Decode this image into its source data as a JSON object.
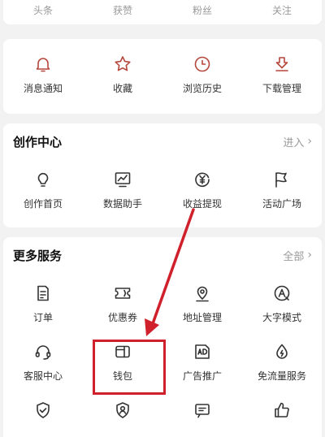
{
  "stats": [
    "头条",
    "获赞",
    "粉丝",
    "关注"
  ],
  "quick": [
    {
      "label": "消息通知",
      "icon": "bell-icon"
    },
    {
      "label": "收藏",
      "icon": "star-icon"
    },
    {
      "label": "浏览历史",
      "icon": "clock-icon"
    },
    {
      "label": "下载管理",
      "icon": "download-icon"
    }
  ],
  "creator": {
    "title": "创作中心",
    "link": "进入",
    "items": [
      {
        "label": "创作首页",
        "icon": "lightbulb-icon"
      },
      {
        "label": "数据助手",
        "icon": "chart-icon"
      },
      {
        "label": "收益提现",
        "icon": "yen-coin-icon"
      },
      {
        "label": "活动广场",
        "icon": "flag-icon"
      }
    ]
  },
  "more": {
    "title": "更多服务",
    "link": "全部",
    "rows": [
      [
        {
          "label": "订单",
          "icon": "document-icon"
        },
        {
          "label": "优惠券",
          "icon": "coupon-icon"
        },
        {
          "label": "地址管理",
          "icon": "location-pin-icon"
        },
        {
          "label": "大字模式",
          "icon": "large-text-icon"
        }
      ],
      [
        {
          "label": "客服中心",
          "icon": "headset-icon"
        },
        {
          "label": "钱包",
          "icon": "wallet-icon"
        },
        {
          "label": "广告推广",
          "icon": "ad-icon"
        },
        {
          "label": "免流量服务",
          "icon": "water-drop-icon"
        }
      ]
    ],
    "partial_icons": [
      "shield-check-icon",
      "user-badge-icon",
      "message-icon",
      "thumbs-up-icon"
    ]
  },
  "colors": {
    "accent": "#b5473d",
    "highlight": "#d0202c"
  }
}
